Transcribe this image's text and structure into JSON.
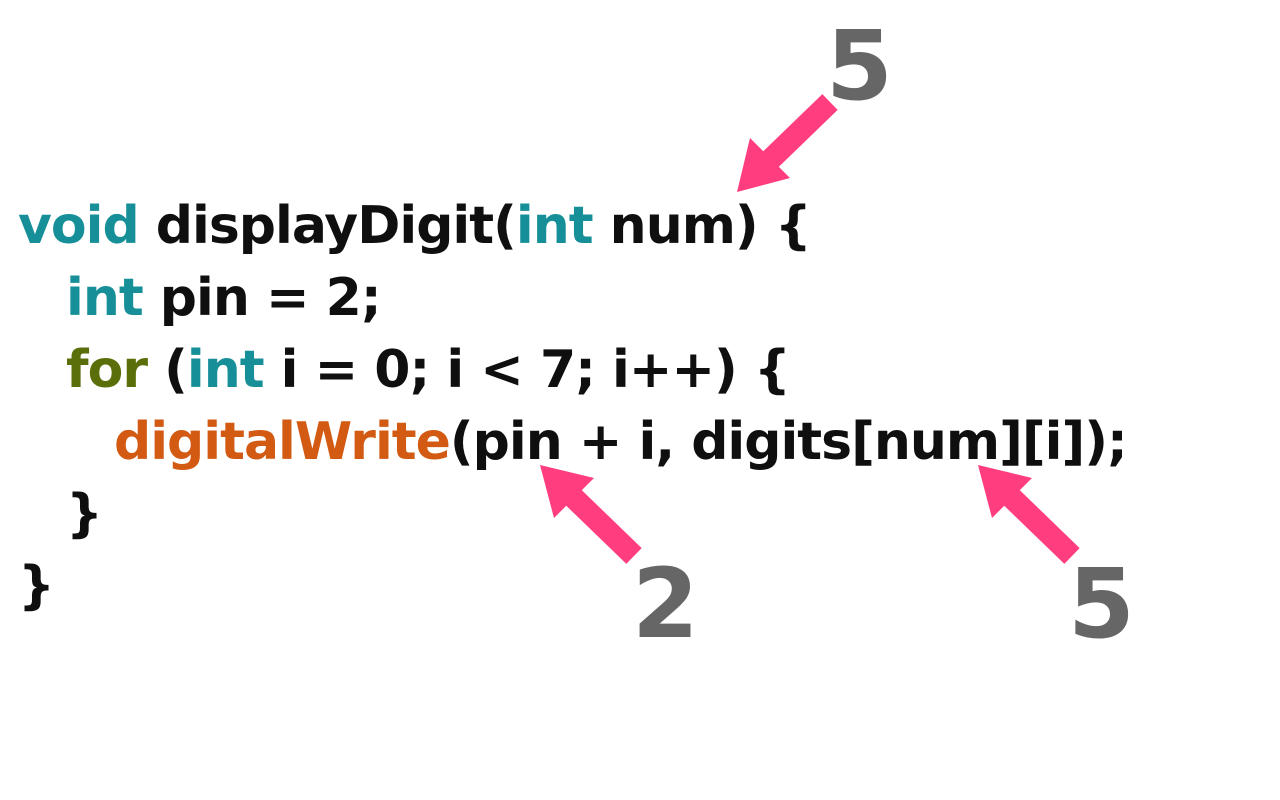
{
  "code": {
    "line1": {
      "kw": "void",
      "rest": " displayDigit(",
      "type": "int",
      "end": " num) {"
    },
    "line2": {
      "type": "int",
      "rest": " pin = 2;"
    },
    "line3": {
      "kw": "for",
      "open": " (",
      "type": "int",
      "rest": " i = 0; i < 7; i++) {"
    },
    "line4": {
      "fn": "digitalWrite",
      "rest": "(pin + i, digits[num][i]);"
    },
    "line5": {
      "text": "}"
    },
    "line6": {
      "text": "}"
    }
  },
  "annotations": {
    "num_param_value": "5",
    "pin_value": "2",
    "digits_index_value": "5"
  },
  "colors": {
    "type_keyword": "#168f98",
    "control_keyword": "#5a6e0a",
    "function_call": "#d35a12",
    "arrow": "#ff3d7f",
    "annotation_text": "#666666"
  }
}
